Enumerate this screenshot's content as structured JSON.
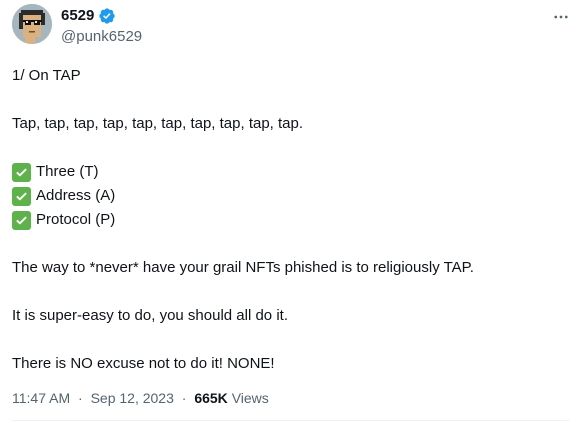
{
  "author": {
    "display_name": "6529",
    "handle": "@punk6529",
    "avatar_icon": "cryptopunk-avatar",
    "verified_icon": "verified-badge-icon",
    "verified_color": "#1d9bf0"
  },
  "tweet": {
    "lines": {
      "intro": "1/ On TAP",
      "taps": "Tap, tap, tap, tap, tap, tap, tap, tap, tap, tap.",
      "check_three": "Three (T)",
      "check_address": "Address (A)",
      "check_protocol": "Protocol (P)",
      "never": "The way to *never* have your grail NFTs phished is to religiously TAP.",
      "easy": "It is super-easy to do, you should all do it.",
      "excuse": "There is NO excuse not to do it!  NONE!"
    },
    "check_icon": "white-check-mark-icon",
    "check_color": "#5db34a"
  },
  "meta": {
    "time": "11:47 AM",
    "separator": "·",
    "date": "Sep 12, 2023",
    "views_count": "665K",
    "views_label": "Views"
  },
  "actions": {
    "more_icon": "more-options-icon"
  }
}
